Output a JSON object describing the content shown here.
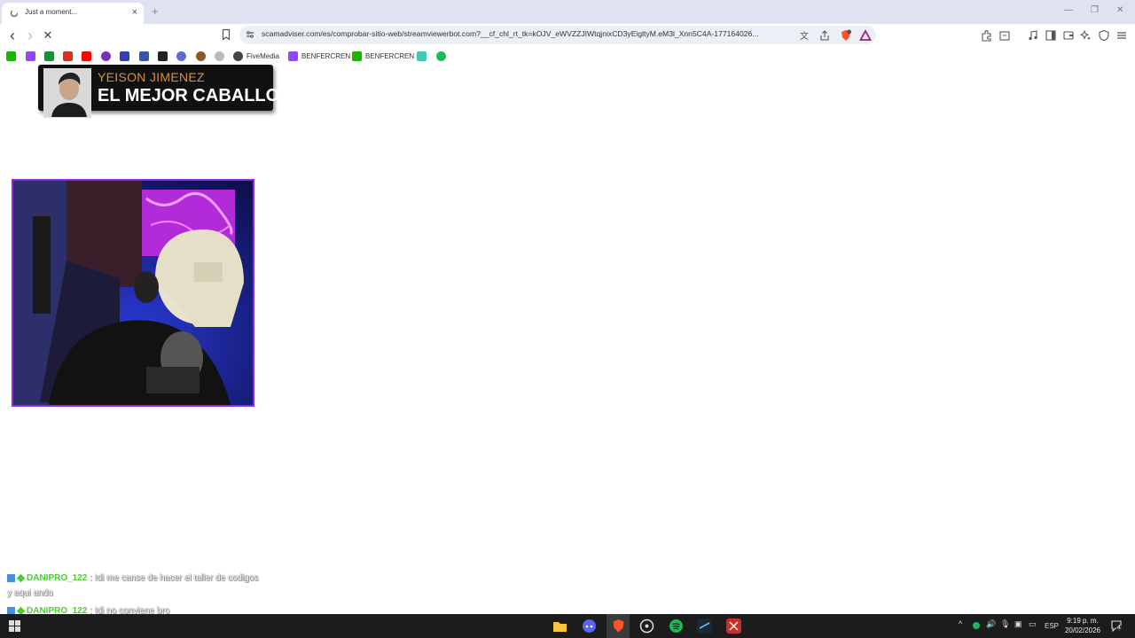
{
  "tab": {
    "title": "Just a moment...",
    "close": "×"
  },
  "window": {
    "new_tab": "+",
    "minimize": "—",
    "restore": "❐",
    "close": "✕"
  },
  "toolbar": {
    "back": "‹",
    "forward": "›",
    "stop": "✕"
  },
  "address": {
    "url": "scamadviser.com/es/comprobar-sitio-web/streamviewerbot.com?__cf_chl_rt_tk=kOJV_eWVZZJIWtqjnixCD3yEigltyM.eM3l_Xnn5C4A-177164026..."
  },
  "bookmarks": [
    {
      "label": "",
      "icon": "kick-icon",
      "color": "#1db500"
    },
    {
      "label": "",
      "icon": "twitch-icon",
      "color": "#9146ff"
    },
    {
      "label": "",
      "icon": "app-icon",
      "color": "#1b8f3a"
    },
    {
      "label": "",
      "icon": "gmail-icon",
      "color": "#d93025"
    },
    {
      "label": "",
      "icon": "youtube-icon",
      "color": "#ff0000"
    },
    {
      "label": "",
      "icon": "app-icon",
      "color": "#7b2cbf"
    },
    {
      "label": "",
      "icon": "app-icon",
      "color": "#3b3bb5"
    },
    {
      "label": "",
      "icon": "app-icon",
      "color": "#3556a8"
    },
    {
      "label": "",
      "icon": "download-icon",
      "color": "#222222"
    },
    {
      "label": "",
      "icon": "app-icon",
      "color": "#5c6bd6"
    },
    {
      "label": "",
      "icon": "app-icon",
      "color": "#8b5a2b"
    },
    {
      "label": "",
      "icon": "globe-icon",
      "color": "#888888"
    },
    {
      "label": "FiveMedia",
      "icon": "globe-icon",
      "color": "#444444"
    },
    {
      "label": "BENFERCREN",
      "icon": "twitch-icon",
      "color": "#9146ff"
    },
    {
      "label": "BENFERCREN",
      "icon": "kick-icon",
      "color": "#1db500"
    },
    {
      "label": "",
      "icon": "app-icon",
      "color": "#3ec8b5"
    },
    {
      "label": "",
      "icon": "app-icon",
      "color": "#1db954"
    }
  ],
  "overlay": {
    "artist": "YEISON JIMENEZ",
    "song": "EL MEJOR CABALLO"
  },
  "chat": [
    {
      "user": "DANIPRO_122",
      "message": ": Idi me canse de hacer el taller de codigos"
    },
    {
      "user": "",
      "message": "y aqui ando"
    },
    {
      "user": "DANIPRO_122",
      "message": ": Idi no conviene bro"
    }
  ],
  "taskbar": {
    "clock_time": "9:19 p. m.",
    "clock_date": "20/02/2026",
    "lang": "ESP",
    "notifications": "4"
  },
  "colors": {
    "accent": "#8a2be2",
    "chat_user": "#4ccf2d",
    "song_artist": "#d6913f"
  }
}
